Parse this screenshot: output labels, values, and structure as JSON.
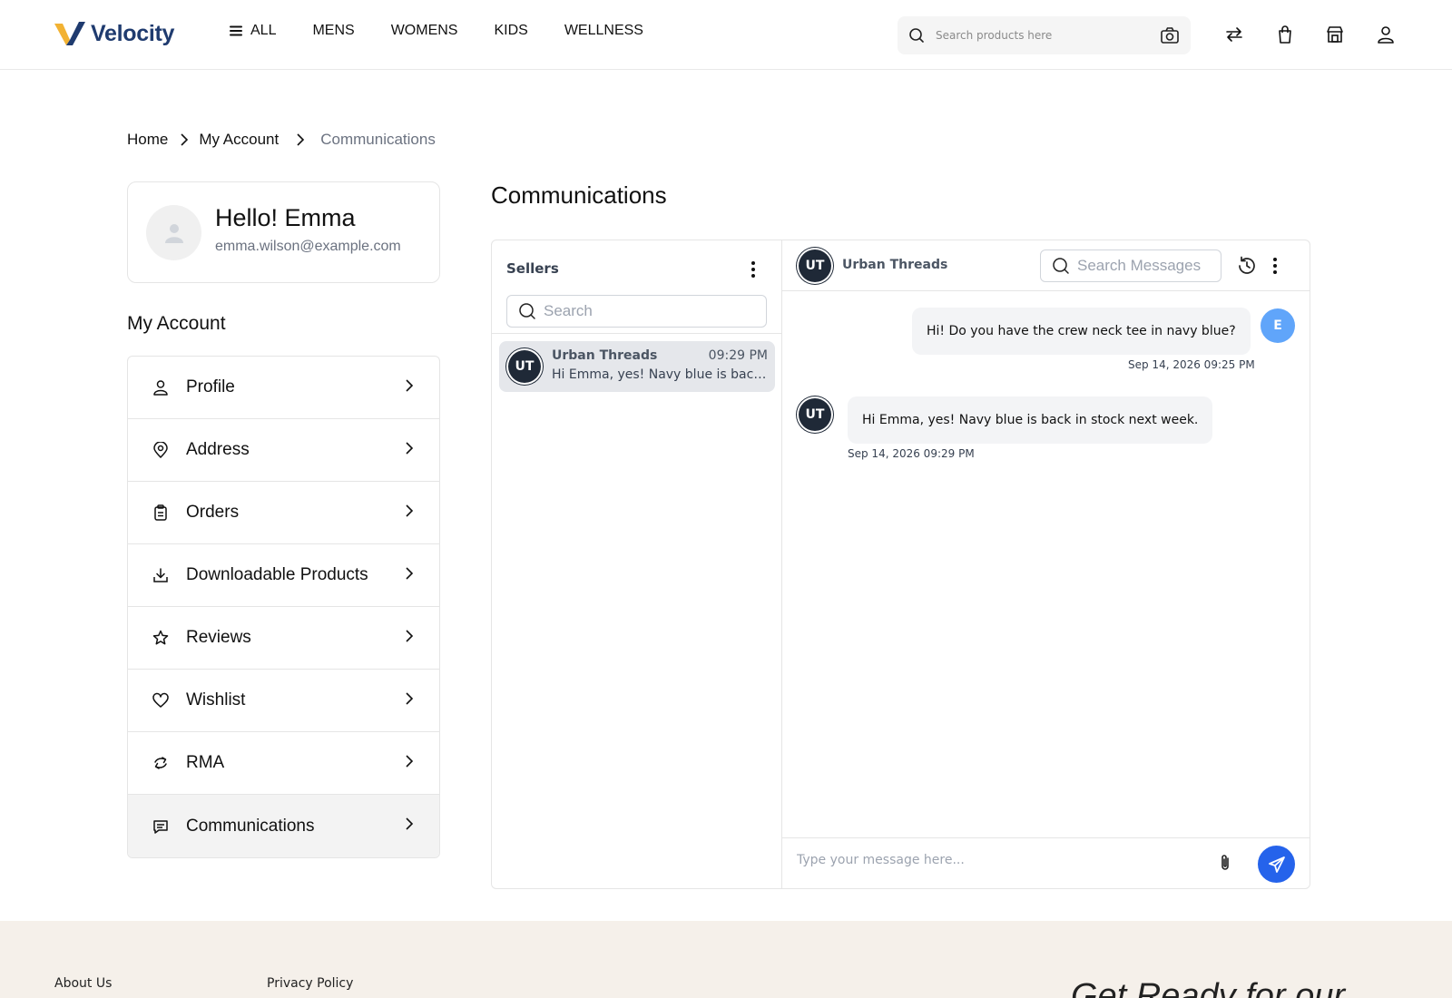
{
  "brand": {
    "name": "Velocity",
    "color": "#1f3b6f",
    "accent": "#f2b233"
  },
  "header": {
    "nav": [
      {
        "label": "ALL",
        "icon": "menu-icon"
      },
      {
        "label": "MENS"
      },
      {
        "label": "WOMENS"
      },
      {
        "label": "KIDS"
      },
      {
        "label": "WELLNESS"
      }
    ],
    "search_placeholder": "Search products here",
    "icons": [
      "search-icon",
      "camera-icon",
      "compare-icon",
      "cart-icon",
      "store-icon",
      "user-icon"
    ]
  },
  "breadcrumb": {
    "items": [
      "Home",
      "My Account"
    ],
    "current": "Communications"
  },
  "profile": {
    "greeting": "Hello! Emma",
    "email": "emma.wilson@example.com"
  },
  "account_menu": {
    "title": "My Account",
    "items": [
      {
        "label": "Profile",
        "icon": "user-icon"
      },
      {
        "label": "Address",
        "icon": "location-pin-icon"
      },
      {
        "label": "Orders",
        "icon": "clipboard-icon"
      },
      {
        "label": "Downloadable Products",
        "icon": "download-icon"
      },
      {
        "label": "Reviews",
        "icon": "star-icon"
      },
      {
        "label": "Wishlist",
        "icon": "heart-icon"
      },
      {
        "label": "RMA",
        "icon": "return-arrows-icon"
      },
      {
        "label": "Communications",
        "icon": "chat-icon",
        "active": true
      }
    ]
  },
  "communications": {
    "title": "Communications",
    "sellers": {
      "title": "Sellers",
      "search_placeholder": "Search",
      "conversations": [
        {
          "initials": "UT",
          "name": "Urban Threads",
          "time": "09:29 PM",
          "preview": "Hi Emma, yes! Navy blue is back in stock next week."
        }
      ]
    },
    "chat": {
      "seller_initials": "UT",
      "seller_name": "Urban Threads",
      "search_placeholder": "Search Messages",
      "messages": [
        {
          "from": "me",
          "avatar": "E",
          "text": "Hi! Do you have the crew neck tee in navy blue?",
          "time": "Sep 14, 2026 09:25 PM"
        },
        {
          "from": "seller",
          "avatar": "UT",
          "text": "Hi Emma, yes! Navy blue is back in stock next week.",
          "time": "Sep 14, 2026 09:29 PM"
        }
      ],
      "input_placeholder": "Type your message here...",
      "send_color": "#2563eb"
    }
  },
  "footer": {
    "links": [
      "About Us",
      "Privacy Policy"
    ],
    "promo": "Get Ready for our"
  }
}
